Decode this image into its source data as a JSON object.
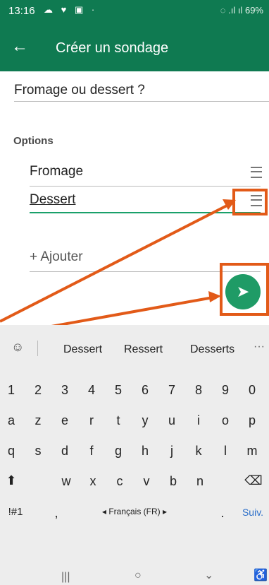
{
  "status": {
    "time": "13:16",
    "left_icons": "☁ ♥ ▣ ·",
    "signal": "◌ .ıl ıl",
    "battery": "69%"
  },
  "appbar": {
    "title": "Créer un sondage"
  },
  "poll": {
    "question": "Fromage ou dessert ?"
  },
  "options": {
    "label": "Options",
    "items": [
      {
        "label": "Fromage"
      },
      {
        "label": "Dessert"
      }
    ],
    "add": "+ Ajouter"
  },
  "keyboard": {
    "suggestions": [
      "Dessert",
      "Ressert",
      "Desserts"
    ],
    "more": "···",
    "row1": [
      "1",
      "2",
      "3",
      "4",
      "5",
      "6",
      "7",
      "8",
      "9",
      "0"
    ],
    "row2": [
      "a",
      "z",
      "e",
      "r",
      "t",
      "y",
      "u",
      "i",
      "o",
      "p"
    ],
    "row3": [
      "q",
      "s",
      "d",
      "f",
      "g",
      "h",
      "j",
      "k",
      "l",
      "m"
    ],
    "row4": [
      "w",
      "x",
      "c",
      "v",
      "b",
      "n"
    ],
    "row5": [
      "!#1",
      ",",
      "◂ Français (FR) ▸",
      ".",
      "Suiv."
    ]
  },
  "nav": {
    "recent": "|||",
    "home": "○",
    "back": "⌄",
    "accessibility": "♿"
  },
  "icons": {
    "back": "arrow-left-icon",
    "drag": "drag-handle-icon",
    "send": "send-icon",
    "emoji": "emoji-icon",
    "shift": "shift-icon",
    "delete": "backspace-icon"
  },
  "colors": {
    "appbar": "#0f7a51",
    "accent": "#1f9b66",
    "highlight": "#e25a18"
  }
}
